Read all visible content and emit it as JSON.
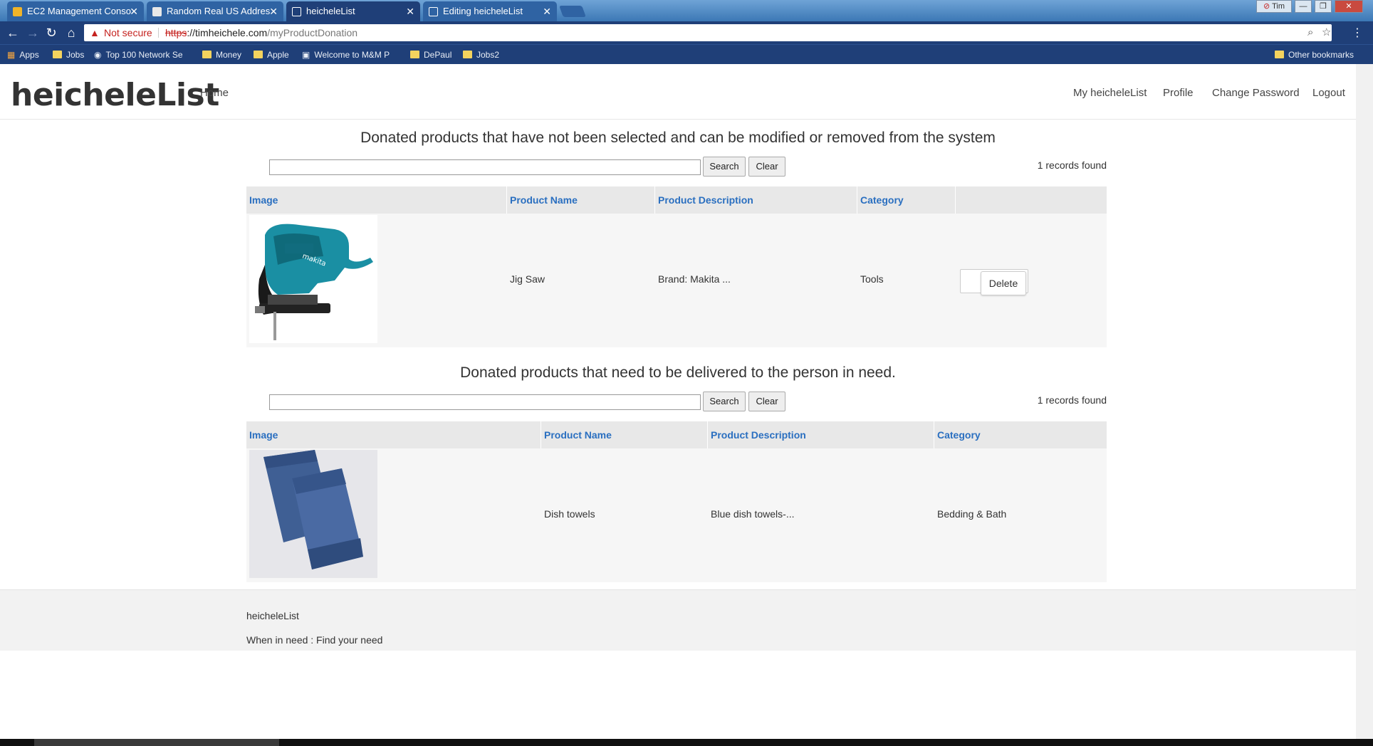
{
  "browser": {
    "tabs": [
      {
        "title": "EC2 Management Conso",
        "active": false
      },
      {
        "title": "Random Real US Addres",
        "active": false
      },
      {
        "title": "heicheleList",
        "active": true
      },
      {
        "title": "Editing heicheleList",
        "active": false
      }
    ],
    "profile_name": "Tim",
    "security_label": "Not secure",
    "url_scheme": "https",
    "url_host": "://timheichele.com",
    "url_path": "/myProductDonation",
    "bookmarks": [
      "Apps",
      "Jobs",
      "Top 100 Network Se",
      "Money",
      "Apple",
      "Welcome to M&M P",
      "DePaul",
      "Jobs2"
    ],
    "other_bookmarks": "Other bookmarks"
  },
  "site": {
    "brand": "heicheleList",
    "nav_left": [
      "Home"
    ],
    "nav_right": [
      "My heicheleList",
      "Profile",
      "Change Password",
      "Logout"
    ]
  },
  "section1": {
    "title": "Donated products that have not been selected and can be modified or removed from the system",
    "search_value": "",
    "search_label": "Search",
    "clear_label": "Clear",
    "records": "1 records found",
    "columns": [
      "Image",
      "Product Name",
      "Product Description",
      "Category",
      ""
    ],
    "rows": [
      {
        "image": "jig-saw",
        "name": "Jig Saw",
        "description": "Brand: Makita ...",
        "category": "Tools",
        "action": "Delete"
      }
    ]
  },
  "section2": {
    "title": "Donated products that need to be delivered to the person in need.",
    "search_value": "",
    "search_label": "Search",
    "clear_label": "Clear",
    "records": "1 records found",
    "columns": [
      "Image",
      "Product Name",
      "Product Description",
      "Category"
    ],
    "rows": [
      {
        "image": "dish-towels",
        "name": "Dish towels",
        "description": "Blue dish towels-...",
        "category": "Bedding & Bath"
      }
    ]
  },
  "footer": {
    "name": "heicheleList",
    "tagline": "When in need : Find your need"
  },
  "colors": {
    "chrome": "#1f3f78",
    "link": "#2a6fc0",
    "header_row": "#e8e8e8",
    "row_bg": "#f6f6f6"
  }
}
